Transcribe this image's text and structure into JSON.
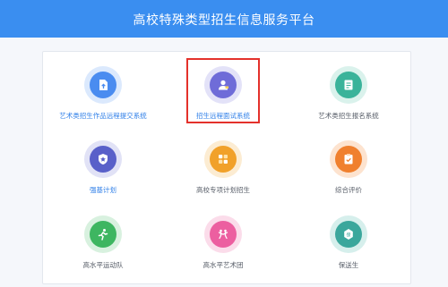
{
  "header": {
    "title": "高校特殊类型招生信息服务平台"
  },
  "tiles": [
    {
      "label": "艺术类招生作品远程提交系统",
      "icon": "upload-document-icon",
      "color": "#4a8cf0",
      "halo": "#dbe9fd",
      "label_color": "blue"
    },
    {
      "label": "招生远程面试系统",
      "icon": "interviewer-icon",
      "color": "#6f6cd8",
      "halo": "#e3e2f8",
      "label_color": "blue"
    },
    {
      "label": "艺术类招生报名系统",
      "icon": "registration-form-icon",
      "color": "#3ab39a",
      "halo": "#daf2ec",
      "label_color": "gray"
    },
    {
      "label": "强基计划",
      "icon": "star-shield-icon",
      "color": "#5960c9",
      "halo": "#e1e2f6",
      "label_color": "blue"
    },
    {
      "label": "高校专项计划招生",
      "icon": "grid-apps-icon",
      "color": "#f1a12a",
      "halo": "#fcecd2",
      "label_color": "gray"
    },
    {
      "label": "综合评价",
      "icon": "clipboard-check-icon",
      "color": "#f0802e",
      "halo": "#fde3cf",
      "label_color": "gray"
    },
    {
      "label": "高水平运动队",
      "icon": "running-athlete-icon",
      "color": "#3eb661",
      "halo": "#d8f1df",
      "label_color": "gray"
    },
    {
      "label": "高水平艺术团",
      "icon": "dancers-icon",
      "color": "#ec5fa0",
      "halo": "#fbdcea",
      "label_color": "gray"
    },
    {
      "label": "保送生",
      "icon": "badge-protected-icon",
      "color": "#3aa79c",
      "halo": "#d6efec",
      "label_color": "gray"
    }
  ],
  "selection": {
    "highlighted_tile": "招生远程面试系统",
    "border_color": "#e4312b"
  }
}
